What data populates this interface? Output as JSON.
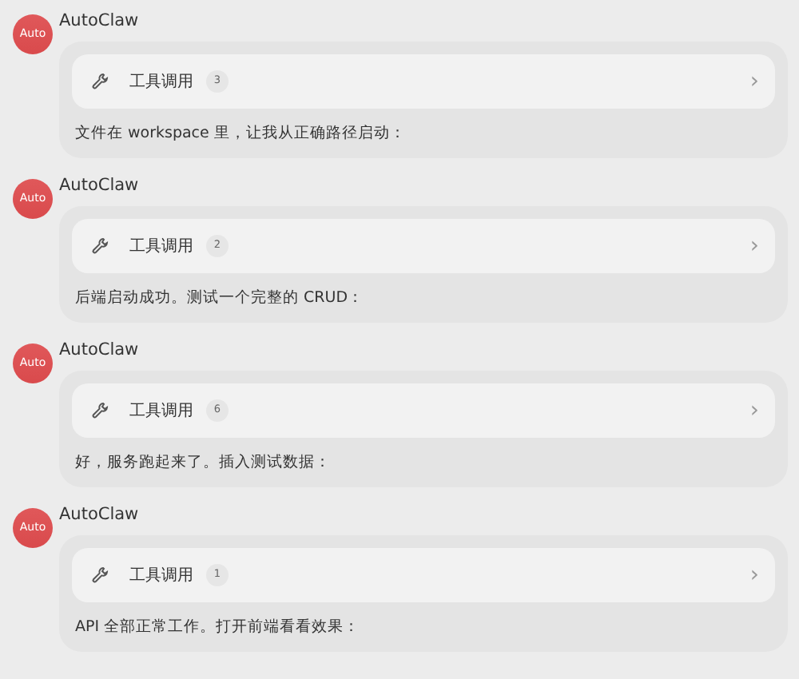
{
  "messages": [
    {
      "avatar": "Auto",
      "sender": "AutoClaw",
      "tool_call": {
        "label": "工具调用",
        "count": "3",
        "arrow": "›"
      },
      "text": "文件在 workspace 里，让我从正确路径启动："
    },
    {
      "avatar": "Auto",
      "sender": "AutoClaw",
      "tool_call": {
        "label": "工具调用",
        "count": "2",
        "arrow": "›"
      },
      "text": "后端启动成功。测试一个完整的 CRUD："
    },
    {
      "avatar": "Auto",
      "sender": "AutoClaw",
      "tool_call": {
        "label": "工具调用",
        "count": "6",
        "arrow": "›"
      },
      "text": "好，服务跑起来了。插入测试数据："
    },
    {
      "avatar": "Auto",
      "sender": "AutoClaw",
      "tool_call": {
        "label": "工具调用",
        "count": "1",
        "arrow": "›"
      },
      "text": "API 全部正常工作。打开前端看看效果："
    }
  ]
}
